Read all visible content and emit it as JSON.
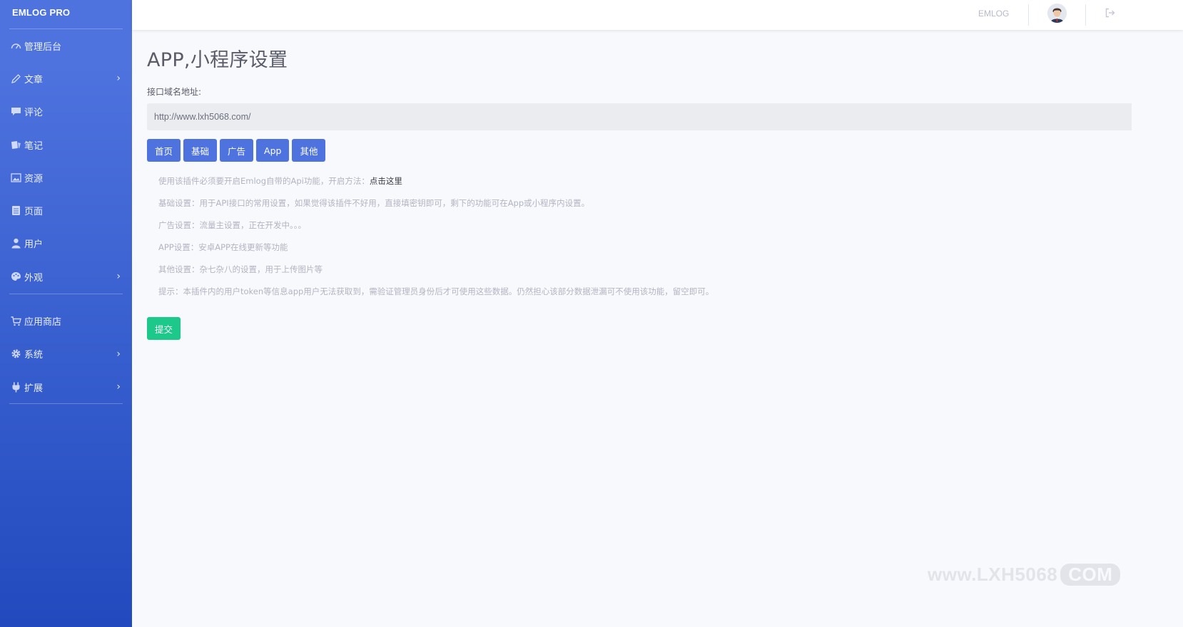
{
  "brand": "EMLOG PRO",
  "sidebar": {
    "items": [
      {
        "label": "管理后台",
        "icon": "dashboard-icon",
        "chevron": false
      },
      {
        "label": "文章",
        "icon": "pencil-icon",
        "chevron": true
      },
      {
        "label": "评论",
        "icon": "comment-icon",
        "chevron": false
      },
      {
        "label": "笔记",
        "icon": "note-icon",
        "chevron": false
      },
      {
        "label": "资源",
        "icon": "image-icon",
        "chevron": false
      },
      {
        "label": "页面",
        "icon": "page-icon",
        "chevron": false
      },
      {
        "label": "用户",
        "icon": "user-icon",
        "chevron": false
      },
      {
        "label": "外观",
        "icon": "palette-icon",
        "chevron": true
      },
      {
        "label": "应用商店",
        "icon": "cart-icon",
        "chevron": false
      },
      {
        "label": "系统",
        "icon": "gear-icon",
        "chevron": true
      },
      {
        "label": "扩展",
        "icon": "plug-icon",
        "chevron": true
      }
    ]
  },
  "topbar": {
    "site_link": "EMLOG",
    "avatar_icon": "avatar-icon",
    "logout_icon": "logout-icon"
  },
  "main": {
    "title": "APP,小程序设置",
    "api_label": "接口域名地址:",
    "api_value": "http://www.lxh5068.com/",
    "tabs": [
      "首页",
      "基础",
      "广告",
      "App",
      "其他"
    ],
    "notes": [
      {
        "text": "使用该插件必须要开启Emlog自带的Api功能，开启方法：",
        "link": "点击这里"
      },
      {
        "text": "基础设置：用于API接口的常用设置，如果觉得该插件不好用，直接填密钥即可，剩下的功能可在App或小程序内设置。"
      },
      {
        "text": "广告设置：流量主设置，正在开发中。。。"
      },
      {
        "text": "APP设置：安卓APP在线更新等功能"
      },
      {
        "text": "其他设置：杂七杂八的设置，用于上传图片等"
      },
      {
        "text": "提示：本插件内的用户token等信息app用户无法获取到，需验证管理员身份后才可使用这些数据。仍然担心该部分数据泄漏可不使用该功能，留空即可。"
      }
    ],
    "submit_label": "提交"
  },
  "watermark": {
    "main": "www.LXH5068",
    "com": "COM"
  },
  "colors": {
    "sidebar_top": "#4e73df",
    "sidebar_bottom": "#224abe",
    "primary": "#4e73df",
    "success": "#1cc88a"
  }
}
